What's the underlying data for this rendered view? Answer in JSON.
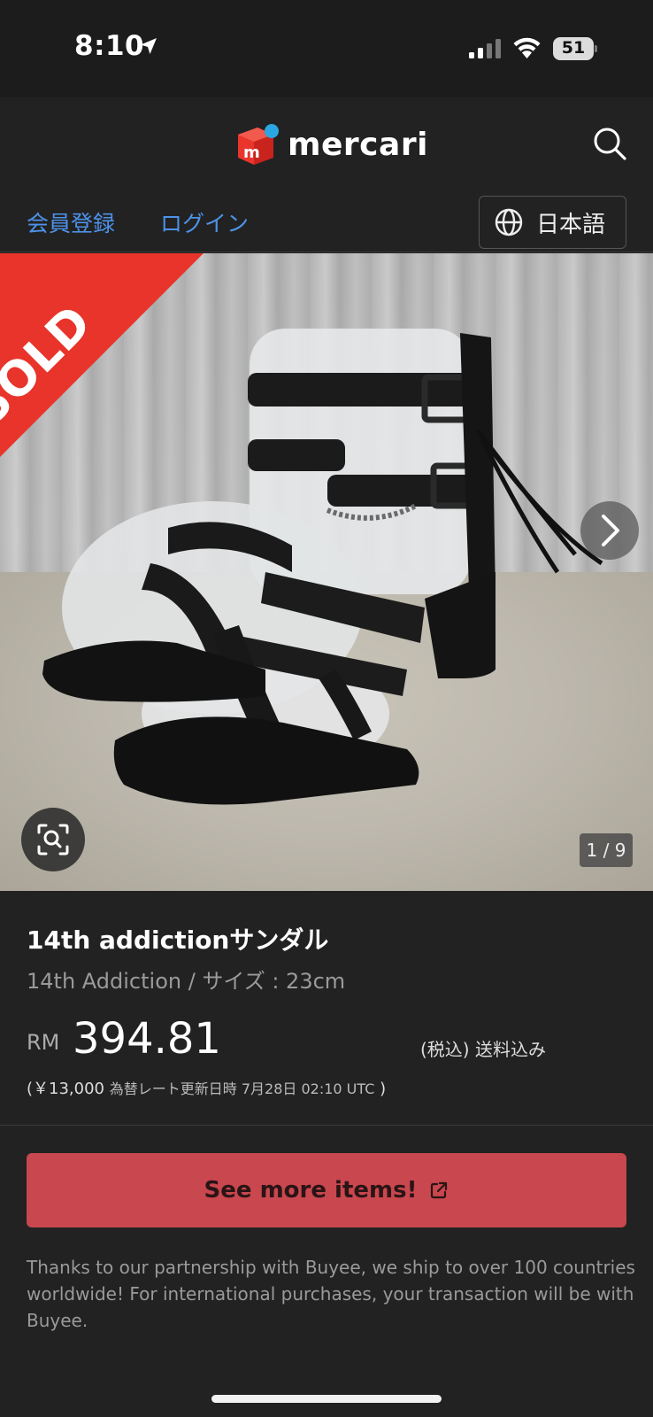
{
  "status_bar": {
    "time": "8:10",
    "battery": "51"
  },
  "header": {
    "brand": "mercari",
    "icons": [
      "mercari-logo-icon",
      "search-icon"
    ]
  },
  "nav": {
    "register": "会員登録",
    "login": "ログイン",
    "language": "日本語"
  },
  "gallery": {
    "sold_label": "SOLD",
    "counter": "1 / 9",
    "current_index": 1,
    "total": 9,
    "icons": [
      "next-arrow-icon",
      "image-search-icon"
    ]
  },
  "product": {
    "title": "14th addictionサンダル",
    "subtitle": "14th Addiction / サイズ : 23cm",
    "currency": "RM",
    "price": "394.81",
    "tax_note": "(税込) 送料込み",
    "yen_price": "(￥13,000",
    "rate_note": "為替レート更新日時 7月28日 02:10 UTC",
    "rate_close": ")"
  },
  "cta": {
    "label": "See more items!",
    "icon": "external-link-icon"
  },
  "partner_text": "Thanks to our partnership with Buyee, we ship to over 100 countries worldwide! For international purchases, your transaction will be with Buyee.",
  "colors": {
    "background": "#222222",
    "link": "#4d92e8",
    "cta": "#c9474e",
    "sold": "#e8342a",
    "brand_red": "#ea352d"
  }
}
